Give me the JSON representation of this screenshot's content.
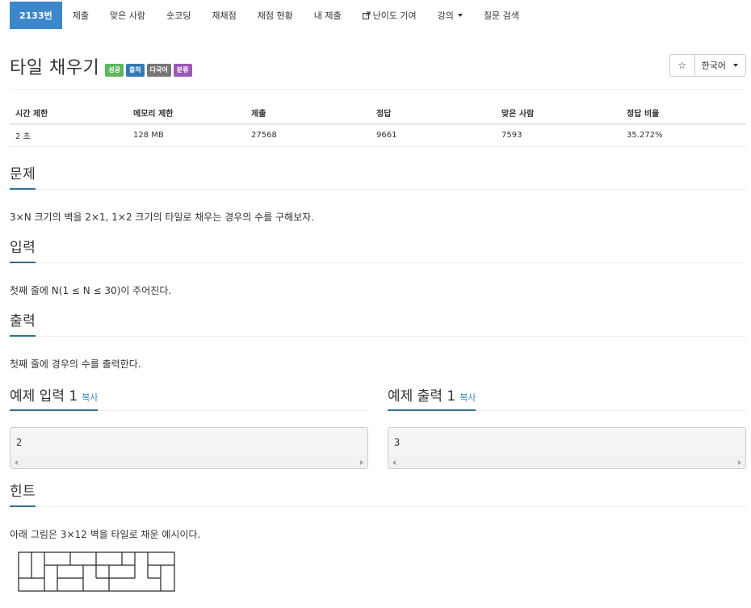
{
  "nav": {
    "problem_id": "2133번",
    "items": [
      "제출",
      "맞은 사람",
      "숏코딩",
      "재채점",
      "채점 현황",
      "내 제출",
      "난이도 기여",
      "강의",
      "질문 검색"
    ]
  },
  "problem": {
    "title": "타일 채우기",
    "badges": [
      {
        "label": "성공",
        "color": "#5cb85c"
      },
      {
        "label": "출처",
        "color": "#337ab7"
      },
      {
        "label": "다국어",
        "color": "#777777"
      },
      {
        "label": "분류",
        "color": "#9b59b6"
      }
    ]
  },
  "toolbar": {
    "star_icon": "☆",
    "language": "한국어"
  },
  "info_table": {
    "headers": [
      "시간 제한",
      "메모리 제한",
      "제출",
      "정답",
      "맞은 사람",
      "정답 비율"
    ],
    "values": [
      "2 초",
      "128 MB",
      "27568",
      "9661",
      "7593",
      "35.272%"
    ]
  },
  "sections": {
    "problem": {
      "title": "문제",
      "text": "3×N 크기의 벽을 2×1, 1×2 크기의 타일로 채우는 경우의 수를 구해보자."
    },
    "input": {
      "title": "입력",
      "text": "첫째 줄에 N(1 ≤ N ≤ 30)이 주어진다."
    },
    "output": {
      "title": "출력",
      "text": "첫째 줄에 경우의 수를 출력한다."
    },
    "hint": {
      "title": "힌트",
      "text": "아래 그림은 3×12 벽을 타일로 채운 예시이다."
    }
  },
  "samples": {
    "input": {
      "title": "예제 입력 1",
      "copy": "복사",
      "value": "2"
    },
    "output": {
      "title": "예제 출력 1",
      "copy": "복사",
      "value": "3"
    }
  },
  "colors": {
    "accent": "#3c87cb",
    "underline": "#31708f"
  }
}
